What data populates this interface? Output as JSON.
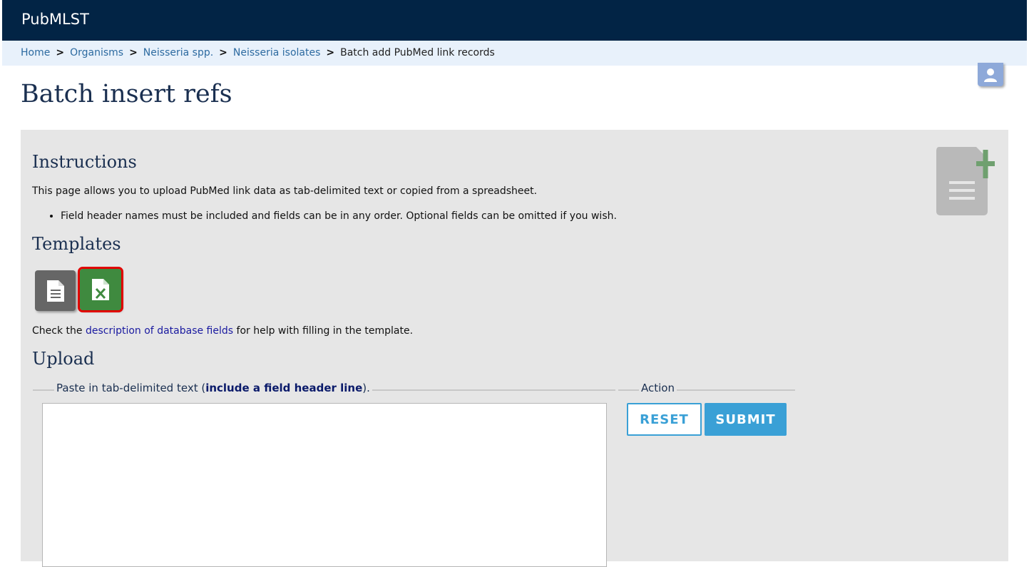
{
  "app": {
    "title": "PubMLST"
  },
  "breadcrumb": {
    "items": [
      "Home",
      "Organisms",
      "Neisseria spp.",
      "Neisseria isolates"
    ],
    "current": "Batch add PubMed link records",
    "separator": ">"
  },
  "page": {
    "title": "Batch insert refs"
  },
  "instructions": {
    "heading": "Instructions",
    "intro": "This page allows you to upload PubMed link data as tab-delimited text or copied from a spreadsheet.",
    "bullets": [
      "Field header names must be included and fields can be in any order. Optional fields can be omitted if you wish."
    ]
  },
  "templates": {
    "heading": "Templates",
    "buttons": [
      {
        "icon": "text-file-icon",
        "color": "#666666"
      },
      {
        "icon": "excel-file-icon",
        "color": "#3f8a3f",
        "highlight": "#e10000"
      }
    ],
    "check_prefix": "Check the",
    "check_link": "description of database fields",
    "check_suffix": "for help with filling in the template."
  },
  "upload": {
    "heading": "Upload",
    "paste_legend_prefix": "Paste in tab-delimited text (",
    "paste_legend_bold": "include a field header line",
    "paste_legend_suffix": ").",
    "paste_value": "",
    "action_legend": "Action",
    "reset_label": "RESET",
    "submit_label": "SUBMIT"
  },
  "colors": {
    "topbar": "#022445",
    "breadcrumb_bg": "#e8f1fb",
    "panel_bg": "#e6e6e6",
    "accent": "#3aa0d6"
  }
}
